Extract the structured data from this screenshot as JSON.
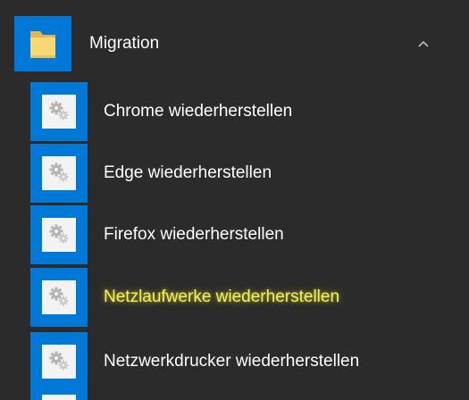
{
  "group": {
    "label": "Migration",
    "icon": "folder-icon",
    "expanded": true
  },
  "items": [
    {
      "label": "Chrome wiederherstellen",
      "icon": "gear-icon"
    },
    {
      "label": "Edge wiederherstellen",
      "icon": "gear-icon"
    },
    {
      "label": "Firefox wiederherstellen",
      "icon": "gear-icon"
    },
    {
      "label": "Netzlaufwerke wiederherstellen",
      "icon": "gear-icon",
      "highlighted": true
    },
    {
      "label": "Netzwerkdrucker wiederherstellen",
      "icon": "gear-icon"
    }
  ],
  "colors": {
    "background": "#2b2b2b",
    "tile": "#0078d7",
    "text": "#ffffff",
    "highlight": "#f2f25a",
    "folder": "#f8d775"
  }
}
